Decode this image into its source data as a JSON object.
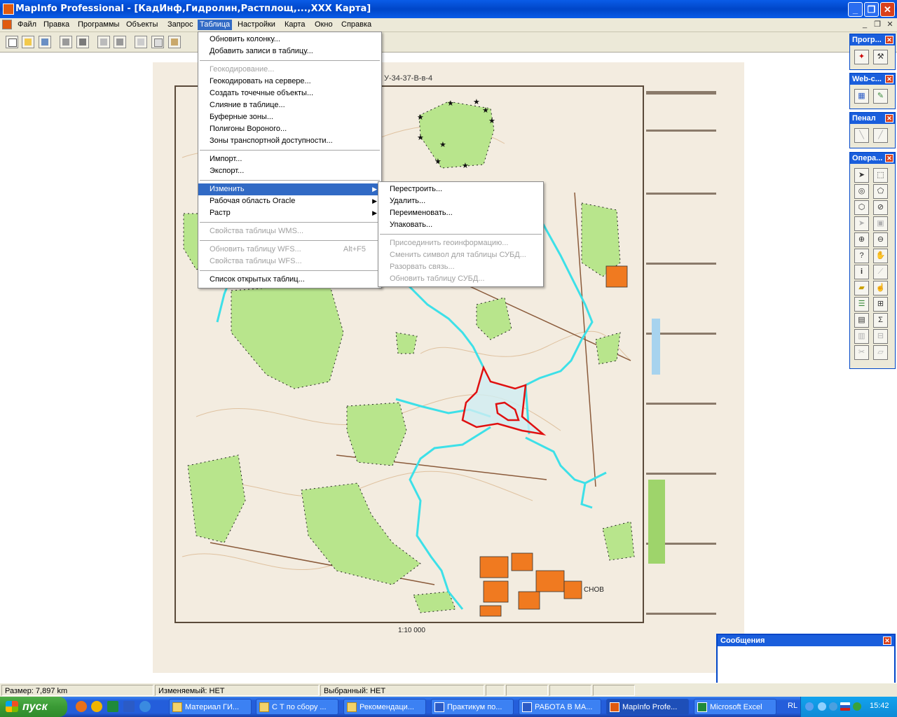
{
  "window": {
    "title": "MapInfo Professional - [КадИнф,Гидролин,Растплощ,...,ХХХ Карта]"
  },
  "menubar": {
    "items": [
      "Файл",
      "Правка",
      "Программы",
      "Объекты",
      "Запрос",
      "Таблица",
      "Настройки",
      "Карта",
      "Окно",
      "Справка"
    ],
    "active": "Таблица"
  },
  "table_menu": {
    "items": [
      {
        "label": "Обновить колонку...",
        "disabled": false
      },
      {
        "label": "Добавить записи в таблицу...",
        "disabled": false
      },
      {
        "label": "Геокодирование...",
        "disabled": true
      },
      {
        "label": "Геокодировать на сервере...",
        "disabled": false
      },
      {
        "label": "Создать точечные объекты...",
        "disabled": false
      },
      {
        "label": "Слияние в таблице...",
        "disabled": false
      },
      {
        "label": "Буферные зоны...",
        "disabled": false
      },
      {
        "label": "Полигоны Вороного...",
        "disabled": false
      },
      {
        "label": "Зоны транспортной доступности...",
        "disabled": false
      },
      {
        "label": "Импорт...",
        "disabled": false
      },
      {
        "label": "Экспорт...",
        "disabled": false
      },
      {
        "label": "Изменить",
        "disabled": false,
        "submenu": true,
        "selected": true
      },
      {
        "label": "Рабочая область Oracle",
        "disabled": false,
        "submenu": true
      },
      {
        "label": "Растр",
        "disabled": false,
        "submenu": true
      },
      {
        "label": "Свойства таблицы WMS...",
        "disabled": true
      },
      {
        "label": "Обновить таблицу WFS...",
        "disabled": true,
        "shortcut": "Alt+F5"
      },
      {
        "label": "Свойства таблицы WFS...",
        "disabled": true
      },
      {
        "label": "Список открытых таблиц...",
        "disabled": false
      }
    ]
  },
  "modify_submenu": {
    "items": [
      {
        "label": "Перестроить...",
        "disabled": false
      },
      {
        "label": "Удалить...",
        "disabled": false
      },
      {
        "label": "Переименовать...",
        "disabled": false
      },
      {
        "label": "Упаковать...",
        "disabled": false
      },
      {
        "label": "Присоединить геоинформацию...",
        "disabled": true
      },
      {
        "label": "Сменить символ для таблицы СУБД...",
        "disabled": true
      },
      {
        "label": "Разорвать связь...",
        "disabled": true
      },
      {
        "label": "Обновить таблицу СУБД...",
        "disabled": true
      }
    ]
  },
  "map": {
    "sheet_label": "У-34-37-В-в-4",
    "town_label": "СНОВ",
    "scale_label": "1:10 000",
    "colors": {
      "forest": "#b8e58c",
      "river": "#3de0e8",
      "selection": "#e01010",
      "settlement": "#f07a20",
      "paper": "#f3ece0",
      "contour": "#d9b68e"
    }
  },
  "toolwindows": [
    {
      "title": "Прогр...",
      "icons": [
        "runner-icon",
        "tool-manager-icon"
      ]
    },
    {
      "title": "Web-с...",
      "icons": [
        "web-map-icon",
        "web-service-icon"
      ]
    },
    {
      "title": "Пенал",
      "icons": [
        "line-icon",
        "polyline-icon"
      ]
    },
    {
      "title": "Опера...",
      "icons": [
        "select-arrow-icon",
        "marquee-select-icon",
        "radius-select-icon",
        "polygon-select-icon",
        "boundary-select-icon",
        "invert-select-icon",
        "unselect-icon",
        "graph-select-icon",
        "zoom-in-icon",
        "zoom-out-icon",
        "change-view-icon",
        "grabber-icon",
        "info-icon",
        "hotlink-icon",
        "ruler-icon",
        "drag-map-icon",
        "layer-control-icon",
        "distance-icon",
        "legend-icon",
        "statistics-icon",
        "browser-icon",
        "redistrict-icon",
        "clip-icon",
        "label-icon"
      ]
    }
  ],
  "statusbar": {
    "size": "Размер: 7,897 km",
    "editable": "Изменяемый: НЕТ",
    "selected": "Выбранный: НЕТ"
  },
  "messages": {
    "title": "Сообщения"
  },
  "taskbar": {
    "start": "пуск",
    "tasks": [
      {
        "label": "Материал ГИ...",
        "icon": "folder"
      },
      {
        "label": "С Т по сбору ...",
        "icon": "folder"
      },
      {
        "label": "Рекомендаци...",
        "icon": "folder"
      },
      {
        "label": "Практикум по...",
        "icon": "word"
      },
      {
        "label": "РАБОТА В МА...",
        "icon": "word"
      },
      {
        "label": "MapInfo Profe...",
        "icon": "mapinfo",
        "active": true
      },
      {
        "label": "Microsoft Excel",
        "icon": "excel"
      }
    ],
    "lang": "RL",
    "clock": "15:42"
  }
}
